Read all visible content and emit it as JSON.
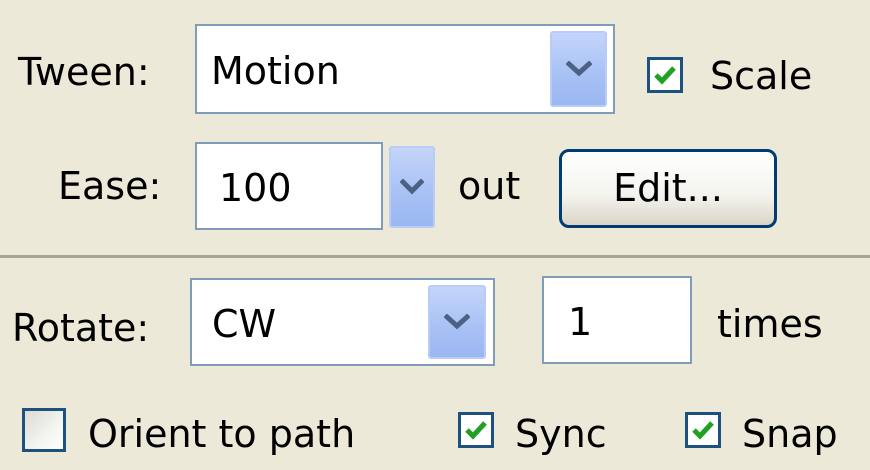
{
  "tween": {
    "label": "Tween:",
    "value": "Motion",
    "dropdown_icon": "chevron-down-icon",
    "scale_label": "Scale",
    "scale_checked": true
  },
  "ease": {
    "label": "Ease:",
    "value": "100",
    "dropdown_icon": "chevron-down-icon",
    "direction_text": "out",
    "edit_label": "Edit..."
  },
  "rotate": {
    "label": "Rotate:",
    "value": "CW",
    "dropdown_icon": "chevron-down-icon",
    "times_value": "1",
    "times_label": "times"
  },
  "options": {
    "orient_label": "Orient to path",
    "orient_checked": false,
    "sync_label": "Sync",
    "sync_checked": true,
    "snap_label": "Snap",
    "snap_checked": true
  },
  "colors": {
    "background": "#ECE9D8",
    "check_green": "#21A121",
    "dropdown_blue": "#A9C2F5",
    "border_blue": "#1C5180"
  }
}
